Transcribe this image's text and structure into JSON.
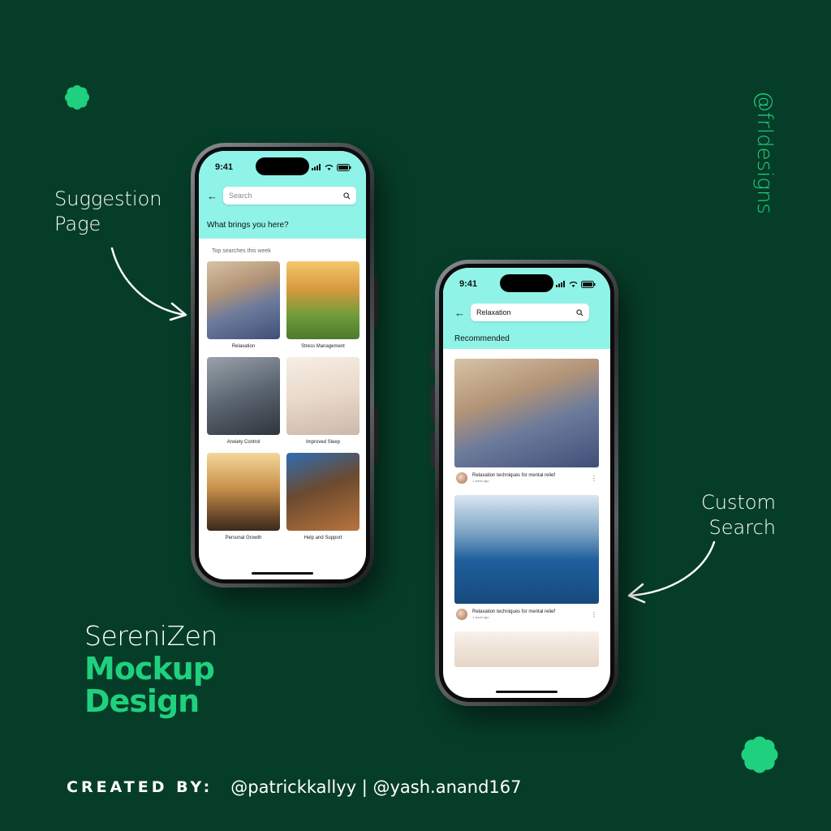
{
  "annotations": {
    "suggestion_label": [
      "Suggestion",
      "Page"
    ],
    "custom_search_label": [
      "Custom",
      "Search"
    ],
    "handle": "@frldesigns"
  },
  "brand": {
    "name": "SereniZen",
    "line2": "Mockup",
    "line3": "Design"
  },
  "credits": {
    "label": "CREATED BY:",
    "authors": "@patrickkallyy | @yash.anand167"
  },
  "colors": {
    "background": "#063d28",
    "accent_green": "#1fd17e",
    "header_cyan": "#8ff3e8"
  },
  "phone_left": {
    "time": "9:41",
    "search_placeholder": "Search",
    "header_title": "What brings you here?",
    "section_title": "Top searches this week",
    "cards": [
      {
        "label": "Relaxation"
      },
      {
        "label": "Stress Management"
      },
      {
        "label": "Anxiety Control"
      },
      {
        "label": "Improved Sleep"
      },
      {
        "label": "Personal Growth"
      },
      {
        "label": "Help and Support"
      }
    ]
  },
  "phone_right": {
    "time": "9:41",
    "search_value": "Relaxation",
    "header_title": "Recommended",
    "posts": [
      {
        "title": "Relaxation techniques for mental relief",
        "date": "1 week ago"
      },
      {
        "title": "Relaxation techniques for mental relief",
        "date": "1 week ago"
      }
    ]
  },
  "icons": [
    "flower-icon",
    "back-arrow-icon",
    "search-icon",
    "signal-icon",
    "wifi-icon",
    "battery-icon",
    "more-icon"
  ]
}
